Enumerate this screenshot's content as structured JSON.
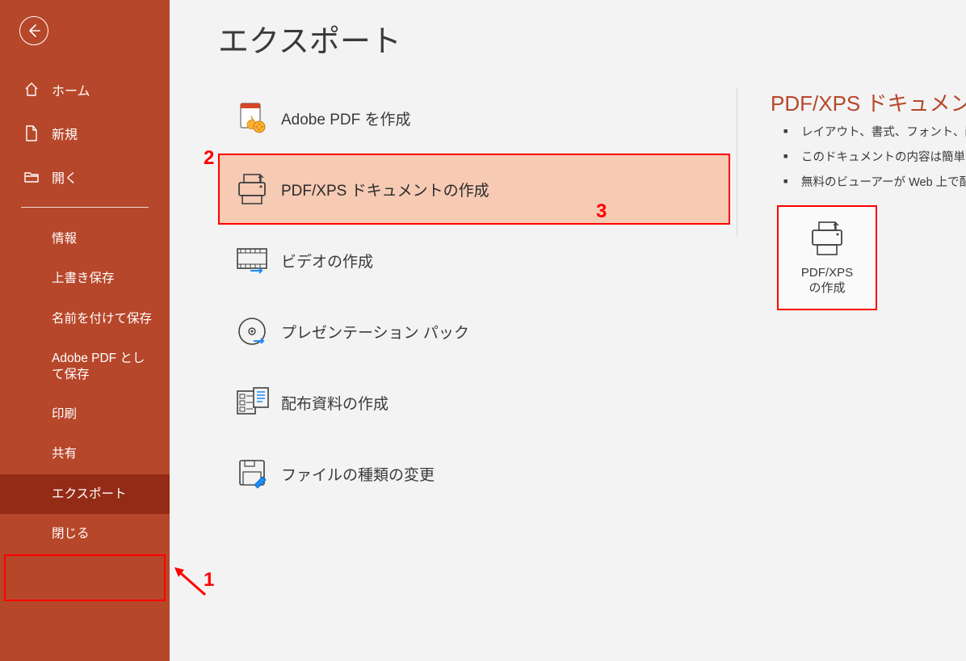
{
  "page_title": "エクスポート",
  "sidebar": {
    "nav1": {
      "home": "ホーム",
      "new": "新規",
      "open": "開く"
    },
    "nav2": {
      "info": "情報",
      "save": "上書き保存",
      "save_as": "名前を付けて保存",
      "adobe_save": "Adobe PDF として保存",
      "print": "印刷",
      "share": "共有",
      "export": "エクスポート",
      "close": "閉じる"
    }
  },
  "export_options": {
    "adobe_pdf": "Adobe PDF を作成",
    "pdf_xps": "PDF/XPS ドキュメントの作成",
    "video": "ビデオの作成",
    "package": "プレゼンテーション パック",
    "handouts": "配布資料の作成",
    "change_type": "ファイルの種類の変更"
  },
  "right_pane": {
    "title": "PDF/XPS ドキュメントの作成",
    "bullets": {
      "b1": "レイアウト、書式、フォント、画像がそのまま維持されます",
      "b2": "このドキュメントの内容は簡単に変更できません",
      "b3": "無料のビューアーが Web 上で配布されています"
    },
    "button_line1": "PDF/XPS",
    "button_line2": "の作成"
  },
  "annotations": {
    "n1": "1",
    "n2": "2",
    "n3": "3"
  }
}
